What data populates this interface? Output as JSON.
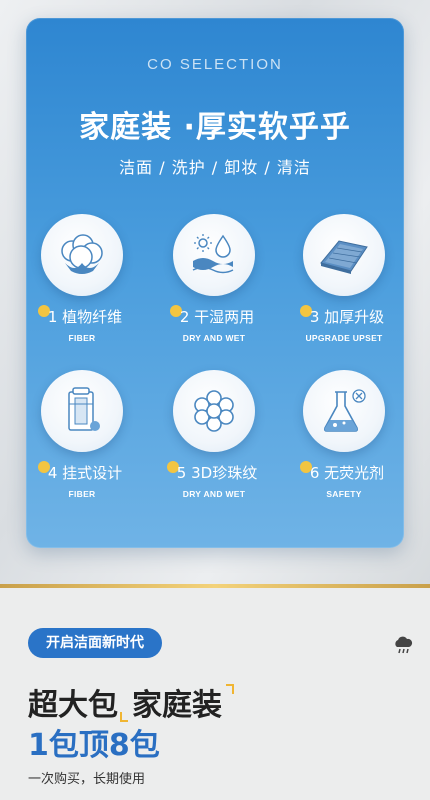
{
  "header": {
    "brand": "CO SELECTION",
    "headline": "家庭装 ·厚实软乎乎",
    "tags": "洁面 / 洗护 / 卸妆 / 清洁"
  },
  "features": [
    {
      "title": "1 植物纤维",
      "subtitle": "FIBER",
      "icon": "cotton-icon"
    },
    {
      "title": "2 干湿两用",
      "subtitle": "DRY AND WET",
      "icon": "sun-water-icon"
    },
    {
      "title": "3 加厚升级",
      "subtitle": "UPGRADE UPSET",
      "icon": "towel-icon"
    },
    {
      "title": "4 挂式设计",
      "subtitle": "FIBER",
      "icon": "hanging-pack-icon"
    },
    {
      "title": "5 3D珍珠纹",
      "subtitle": "DRY AND WET",
      "icon": "pearl-pattern-icon"
    },
    {
      "title": "6 无荧光剂",
      "subtitle": "SAFETY",
      "icon": "flask-icon"
    }
  ],
  "bottom": {
    "pill": "开启洁面新时代",
    "line1_a": "超大包",
    "line1_b": "家庭装",
    "line2": "1包顶8包",
    "note": "一次购买，长期使用"
  },
  "colors": {
    "panel_blue": "#2e86d1",
    "accent_yellow": "#f2c542",
    "pill_blue": "#2a74c8",
    "gold": "#e2bb5e"
  }
}
